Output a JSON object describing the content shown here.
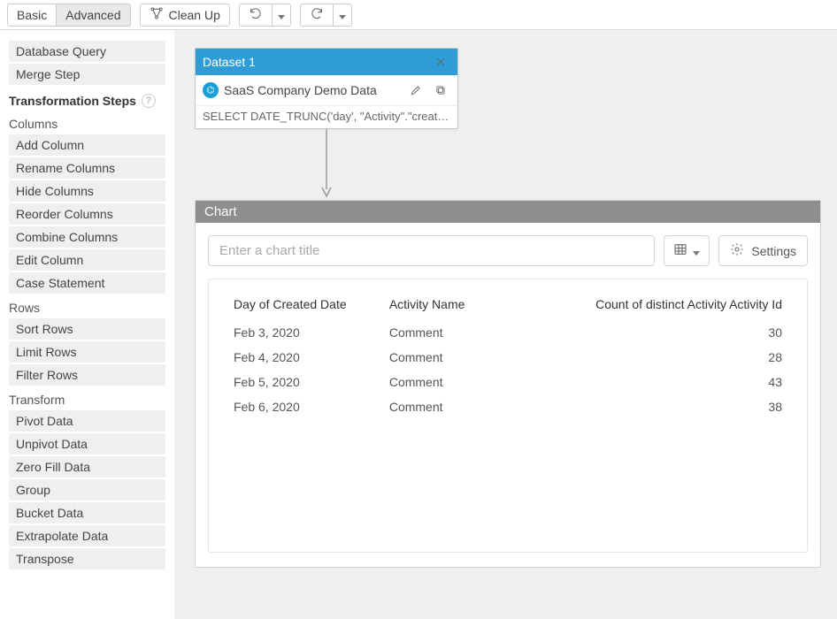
{
  "toolbar": {
    "basic_label": "Basic",
    "advanced_label": "Advanced",
    "cleanup_label": "Clean Up"
  },
  "sidebar": {
    "top_items": [
      {
        "label": "Database Query",
        "name": "database-query"
      },
      {
        "label": "Merge Step",
        "name": "merge-step"
      }
    ],
    "transformation_label": "Transformation Steps",
    "groups": [
      {
        "heading": "Columns",
        "items": [
          {
            "label": "Add Column",
            "name": "add-column"
          },
          {
            "label": "Rename Columns",
            "name": "rename-columns"
          },
          {
            "label": "Hide Columns",
            "name": "hide-columns"
          },
          {
            "label": "Reorder Columns",
            "name": "reorder-columns"
          },
          {
            "label": "Combine Columns",
            "name": "combine-columns"
          },
          {
            "label": "Edit Column",
            "name": "edit-column"
          },
          {
            "label": "Case Statement",
            "name": "case-statement"
          }
        ]
      },
      {
        "heading": "Rows",
        "items": [
          {
            "label": "Sort Rows",
            "name": "sort-rows"
          },
          {
            "label": "Limit Rows",
            "name": "limit-rows"
          },
          {
            "label": "Filter Rows",
            "name": "filter-rows"
          }
        ]
      },
      {
        "heading": "Transform",
        "items": [
          {
            "label": "Pivot Data",
            "name": "pivot-data"
          },
          {
            "label": "Unpivot Data",
            "name": "unpivot-data"
          },
          {
            "label": "Zero Fill Data",
            "name": "zero-fill-data"
          },
          {
            "label": "Group",
            "name": "group"
          },
          {
            "label": "Bucket Data",
            "name": "bucket-data"
          },
          {
            "label": "Extrapolate Data",
            "name": "extrapolate-data"
          },
          {
            "label": "Transpose",
            "name": "transpose"
          }
        ]
      }
    ]
  },
  "dataset_node": {
    "title": "Dataset 1",
    "source_name": "SaaS Company Demo Data",
    "sql_preview": "SELECT DATE_TRUNC('day', \"Activity\".\"created_da..."
  },
  "chart_panel": {
    "header_label": "Chart",
    "title_placeholder": "Enter a chart title",
    "settings_label": "Settings"
  },
  "chart_data": {
    "type": "table",
    "columns": [
      {
        "key": "date",
        "label": "Day of Created Date",
        "align": "left"
      },
      {
        "key": "name",
        "label": "Activity Name",
        "align": "left"
      },
      {
        "key": "count",
        "label": "Count of distinct Activity Activity Id",
        "align": "right"
      }
    ],
    "rows": [
      {
        "date": "Feb 3, 2020",
        "name": "Comment",
        "count": 30
      },
      {
        "date": "Feb 4, 2020",
        "name": "Comment",
        "count": 28
      },
      {
        "date": "Feb 5, 2020",
        "name": "Comment",
        "count": 43
      },
      {
        "date": "Feb 6, 2020",
        "name": "Comment",
        "count": 38
      }
    ]
  }
}
